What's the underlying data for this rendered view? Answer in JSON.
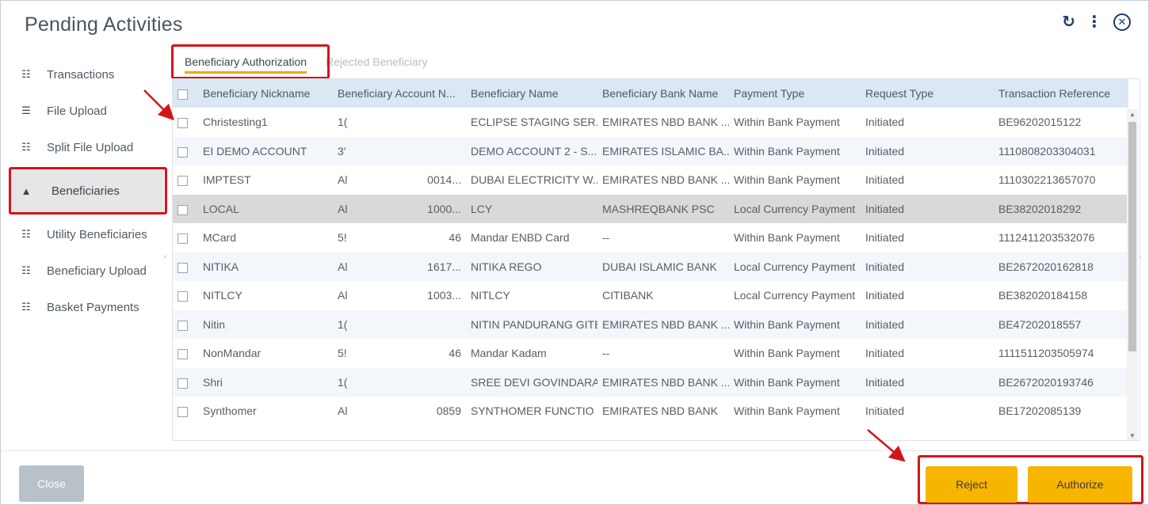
{
  "window": {
    "title": "Pending Activities",
    "actions": {
      "refresh_icon": "refresh-icon",
      "more_icon": "more-vertical-icon",
      "close_icon": "close-circle-icon"
    }
  },
  "sidebar": {
    "items": [
      {
        "label": "Transactions",
        "icon": "transactions-icon"
      },
      {
        "label": "File Upload",
        "icon": "file-upload-icon"
      },
      {
        "label": "Split File Upload",
        "icon": "split-file-icon"
      },
      {
        "label": "Beneficiaries",
        "icon": "user-icon",
        "active": true
      },
      {
        "label": "Utility Beneficiaries",
        "icon": "utility-icon"
      },
      {
        "label": "Beneficiary Upload",
        "icon": "upload-icon"
      },
      {
        "label": "Basket Payments",
        "icon": "basket-icon"
      }
    ]
  },
  "tabs": [
    {
      "label": "Beneficiary Authorization",
      "active": true
    },
    {
      "label": "Rejected Beneficiary",
      "active": false
    }
  ],
  "table": {
    "columns": [
      "Beneficiary Nickname",
      "Beneficiary Account N...",
      "Beneficiary Name",
      "Beneficiary Bank Name",
      "Payment Type",
      "Request Type",
      "Transaction Reference"
    ],
    "rows": [
      {
        "nickname": "Christesting1",
        "acct_a": "1(",
        "acct_b": "",
        "name": "ECLIPSE STAGING SER...",
        "bank": "EMIRATES NBD BANK ...",
        "payment": "Within Bank Payment",
        "request": "Initiated",
        "ref": "BE96202015122"
      },
      {
        "nickname": "EI DEMO ACCOUNT",
        "acct_a": "3'",
        "acct_b": "",
        "name": "DEMO ACCOUNT 2 - S...",
        "bank": "EMIRATES ISLAMIC BA...",
        "payment": "Within Bank Payment",
        "request": "Initiated",
        "ref": "1110808203304031"
      },
      {
        "nickname": "IMPTEST",
        "acct_a": "Al",
        "acct_b": "0014...",
        "name": "DUBAI ELECTRICITY W...",
        "bank": "EMIRATES NBD BANK ...",
        "payment": "Within Bank Payment",
        "request": "Initiated",
        "ref": "1110302213657070"
      },
      {
        "nickname": "LOCAL",
        "acct_a": "Al",
        "acct_b": "1000...",
        "name": "LCY",
        "bank": "MASHREQBANK PSC",
        "payment": "Local Currency Payment",
        "request": "Initiated",
        "ref": "BE38202018292",
        "selected": true
      },
      {
        "nickname": "MCard",
        "acct_a": "5!",
        "acct_b": "46",
        "name": "Mandar ENBD Card",
        "bank": "--",
        "payment": "Within Bank Payment",
        "request": "Initiated",
        "ref": "1112411203532076"
      },
      {
        "nickname": "NITIKA",
        "acct_a": "Al",
        "acct_b": "1617...",
        "name": "NITIKA REGO",
        "bank": "DUBAI ISLAMIC BANK",
        "payment": "Local Currency Payment",
        "request": "Initiated",
        "ref": "BE2672020162818"
      },
      {
        "nickname": "NITLCY",
        "acct_a": "Al",
        "acct_b": "1003...",
        "name": "NITLCY",
        "bank": "CITIBANK",
        "payment": "Local Currency Payment",
        "request": "Initiated",
        "ref": "BE382020184158"
      },
      {
        "nickname": "Nitin",
        "acct_a": "1(",
        "acct_b": "",
        "name": "NITIN PANDURANG GITE",
        "bank": "EMIRATES NBD BANK ...",
        "payment": "Within Bank Payment",
        "request": "Initiated",
        "ref": "BE47202018557"
      },
      {
        "nickname": "NonMandar",
        "acct_a": "5!",
        "acct_b": "46",
        "name": "Mandar Kadam",
        "bank": "--",
        "payment": "Within Bank Payment",
        "request": "Initiated",
        "ref": "1111511203505974"
      },
      {
        "nickname": "Shri",
        "acct_a": "1(",
        "acct_b": "",
        "name": "SREE DEVI GOVINDARAJ",
        "bank": "EMIRATES NBD BANK ...",
        "payment": "Within Bank Payment",
        "request": "Initiated",
        "ref": "BE2672020193746"
      },
      {
        "nickname": "Synthomer",
        "acct_a": "Al",
        "acct_b": "0859",
        "name": "SYNTHOMER FUNCTIO",
        "bank": "EMIRATES NBD BANK",
        "payment": "Within Bank Payment",
        "request": "Initiated",
        "ref": "BE17202085139"
      }
    ]
  },
  "footer": {
    "close_label": "Close",
    "reject_label": "Reject",
    "authorize_label": "Authorize"
  },
  "colors": {
    "accent_yellow": "#f7b500",
    "highlight_red": "#d0161b",
    "header_blue": "#dbe8f4",
    "brand_navy": "#1e3a6e"
  }
}
